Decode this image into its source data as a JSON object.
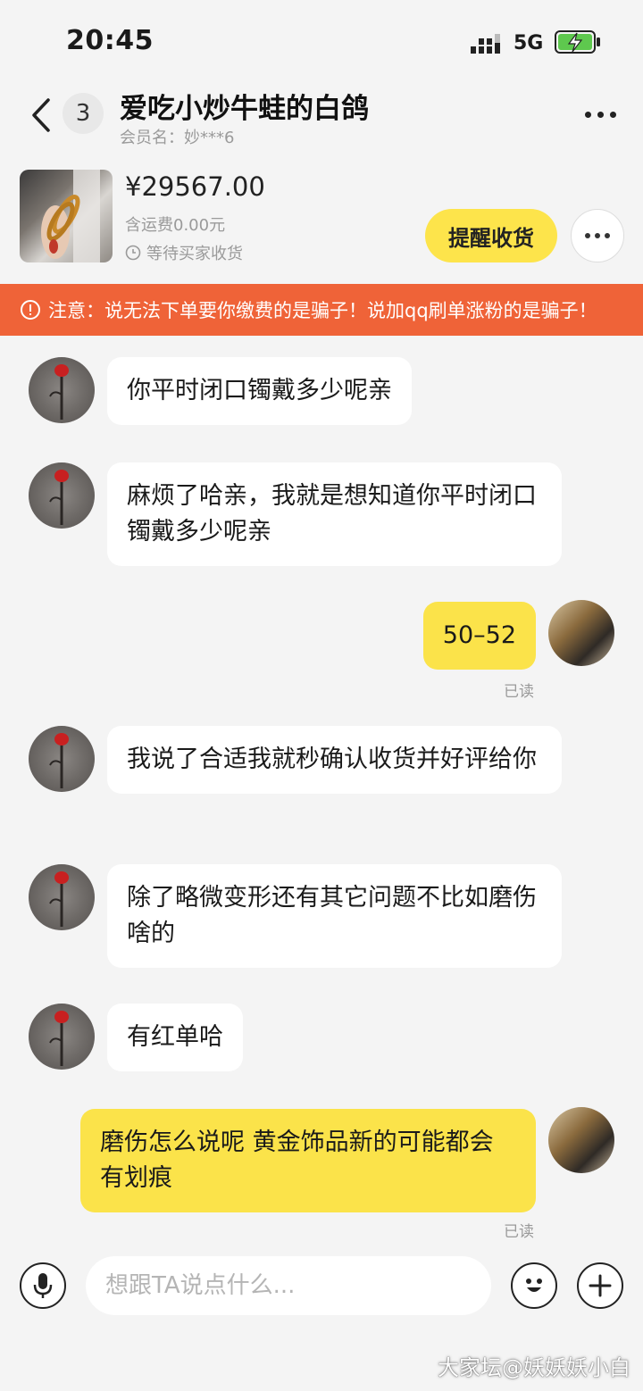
{
  "status_bar": {
    "time": "20:45",
    "network": "5G"
  },
  "header": {
    "unread_count": "3",
    "title": "爱吃小炒牛蛙的白鸽",
    "member_name": "会员名：妙***6"
  },
  "order_card": {
    "price": "¥29567.00",
    "shipping": "含运费0.00元",
    "status": "等待买家收货",
    "remind_button": "提醒收货"
  },
  "warning": {
    "text": "注意：说无法下单要你缴费的是骗子！说加qq刷单涨粉的是骗子！"
  },
  "messages": [
    {
      "side": "in",
      "text": "你平时闭口镯戴多少呢亲"
    },
    {
      "side": "in",
      "text": "麻烦了哈亲，我就是想知道你平时闭口镯戴多少呢亲"
    },
    {
      "side": "out",
      "text": "50–52",
      "read": "已读"
    },
    {
      "side": "in",
      "text": "我说了合适我就秒确认收货并好评给你"
    },
    {
      "side": "in",
      "text": "除了略微变形还有其它问题不比如磨伤啥的"
    },
    {
      "side": "in",
      "text": "有红单哈"
    },
    {
      "side": "out",
      "text": "磨伤怎么说呢 黄金饰品新的可能都会有划痕",
      "read": "已读"
    }
  ],
  "input_bar": {
    "placeholder": "想跟TA说点什么..."
  },
  "watermark": "大家坛@妖妖妖小白",
  "colors": {
    "accent_yellow": "#fde44b",
    "warning_orange": "#ef6338",
    "background": "#f4f4f4"
  }
}
